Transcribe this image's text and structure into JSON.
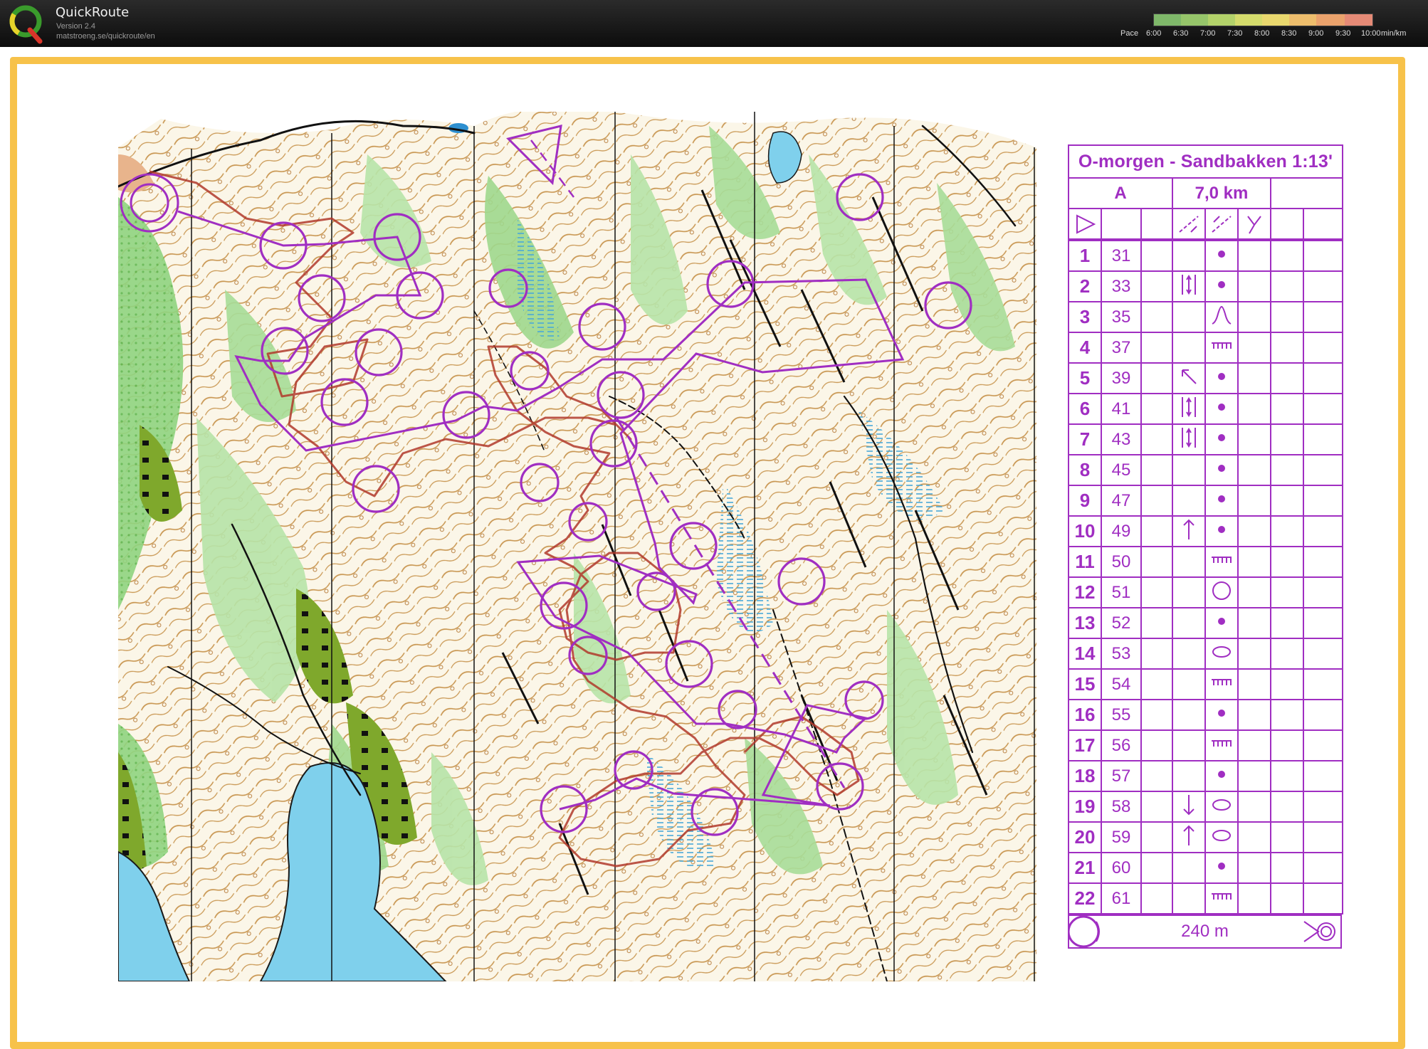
{
  "app": {
    "name": "QuickRoute",
    "version": "Version 2.4",
    "url": "matstroeng.se/quickroute/en"
  },
  "pace_legend": {
    "label": "Pace",
    "ticks": [
      "6:00",
      "6:30",
      "7:00",
      "7:30",
      "8:00",
      "8:30",
      "9:00",
      "9:30",
      "10:00"
    ],
    "unit": "min/km"
  },
  "colors": {
    "frame": "#f7c24a",
    "course": "#a02ec2",
    "route": "#b0382a"
  },
  "description_sheet": {
    "title": "O-morgen - Sandbakken 1:13'",
    "class": "A",
    "length": "7,0 km",
    "controls": [
      {
        "num": "1",
        "code": "31",
        "col_d": "",
        "col_e": "dot"
      },
      {
        "num": "2",
        "code": "33",
        "col_d": "between-lines",
        "col_e": "dot"
      },
      {
        "num": "3",
        "code": "35",
        "col_d": "",
        "col_e": "spur"
      },
      {
        "num": "4",
        "code": "37",
        "col_d": "",
        "col_e": "cliff"
      },
      {
        "num": "5",
        "code": "39",
        "col_d": "arrow-nw",
        "col_e": "dot"
      },
      {
        "num": "6",
        "code": "41",
        "col_d": "between-lines",
        "col_e": "dot"
      },
      {
        "num": "7",
        "code": "43",
        "col_d": "between-lines",
        "col_e": "dot"
      },
      {
        "num": "8",
        "code": "45",
        "col_d": "",
        "col_e": "dot"
      },
      {
        "num": "9",
        "code": "47",
        "col_d": "",
        "col_e": "dot"
      },
      {
        "num": "10",
        "code": "49",
        "col_d": "arrow-n",
        "col_e": "dot"
      },
      {
        "num": "11",
        "code": "50",
        "col_d": "",
        "col_e": "cliff"
      },
      {
        "num": "12",
        "code": "51",
        "col_d": "",
        "col_e": "circle"
      },
      {
        "num": "13",
        "code": "52",
        "col_d": "",
        "col_e": "dot"
      },
      {
        "num": "14",
        "code": "53",
        "col_d": "",
        "col_e": "oval"
      },
      {
        "num": "15",
        "code": "54",
        "col_d": "",
        "col_e": "cliff"
      },
      {
        "num": "16",
        "code": "55",
        "col_d": "",
        "col_e": "dot"
      },
      {
        "num": "17",
        "code": "56",
        "col_d": "",
        "col_e": "cliff"
      },
      {
        "num": "18",
        "code": "57",
        "col_d": "",
        "col_e": "dot"
      },
      {
        "num": "19",
        "code": "58",
        "col_d": "arrow-s",
        "col_e": "oval"
      },
      {
        "num": "20",
        "code": "59",
        "col_d": "arrow-n",
        "col_e": "oval"
      },
      {
        "num": "21",
        "code": "60",
        "col_d": "",
        "col_e": "dot"
      },
      {
        "num": "22",
        "code": "61",
        "col_d": "",
        "col_e": "cliff"
      }
    ],
    "finish_distance": "240 m"
  }
}
